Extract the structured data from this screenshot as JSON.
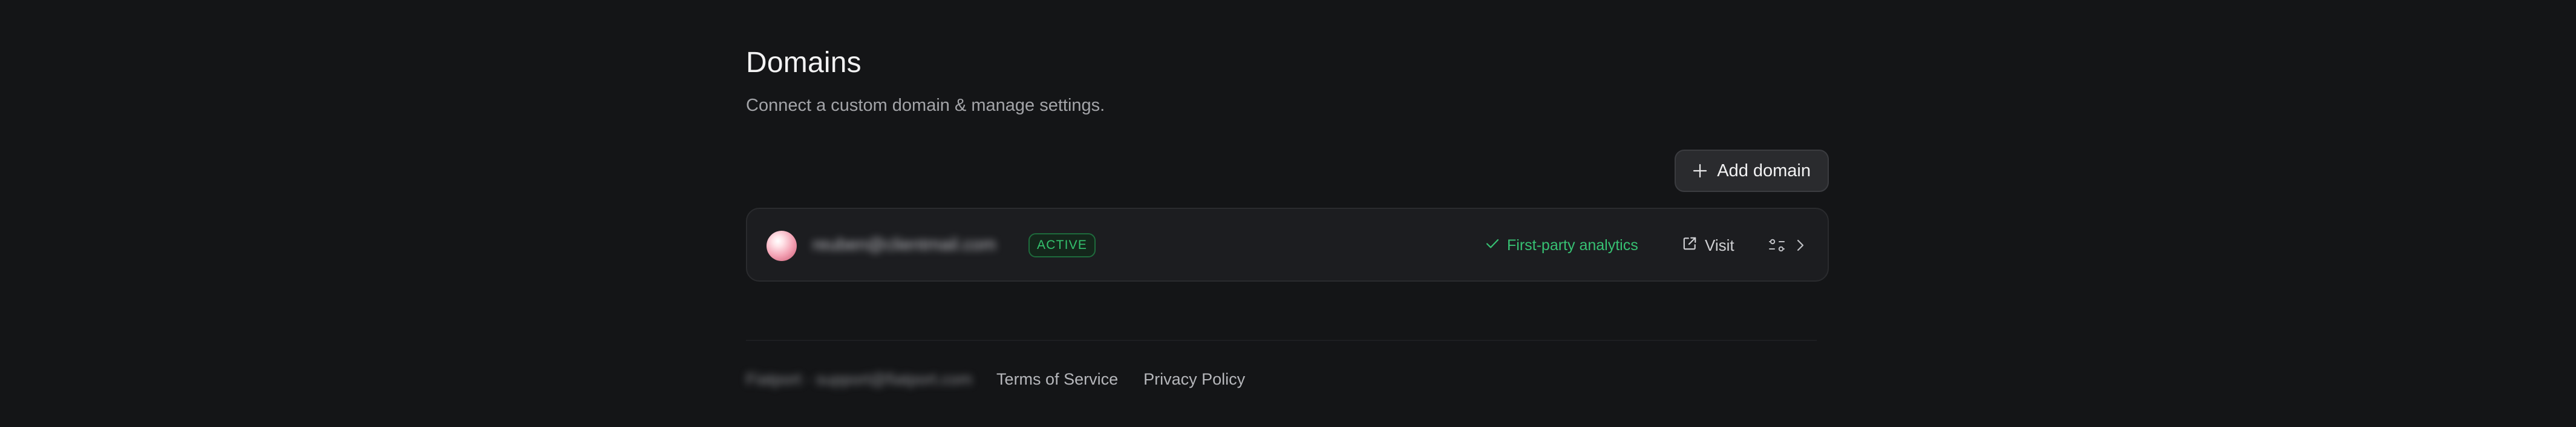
{
  "header": {
    "title": "Domains",
    "subtitle": "Connect a custom domain & manage settings."
  },
  "actions": {
    "add_domain_label": "Add domain"
  },
  "domains": [
    {
      "name": "reuben@clientmail.com",
      "status": "ACTIVE",
      "analytics_label": "First-party analytics",
      "visit_label": "Visit"
    }
  ],
  "footer": {
    "copyright": "Fiatport · support@fiatport.com",
    "links": [
      "Terms of Service",
      "Privacy Policy"
    ]
  },
  "colors": {
    "background": "#141517",
    "active_green": "#34c26e",
    "row_bg": "#1c1d20"
  },
  "icons": {
    "add": "plus-icon",
    "analytics": "check-icon",
    "visit": "external-link-icon",
    "settings": "sliders-icon",
    "open": "chevron-right-icon"
  }
}
